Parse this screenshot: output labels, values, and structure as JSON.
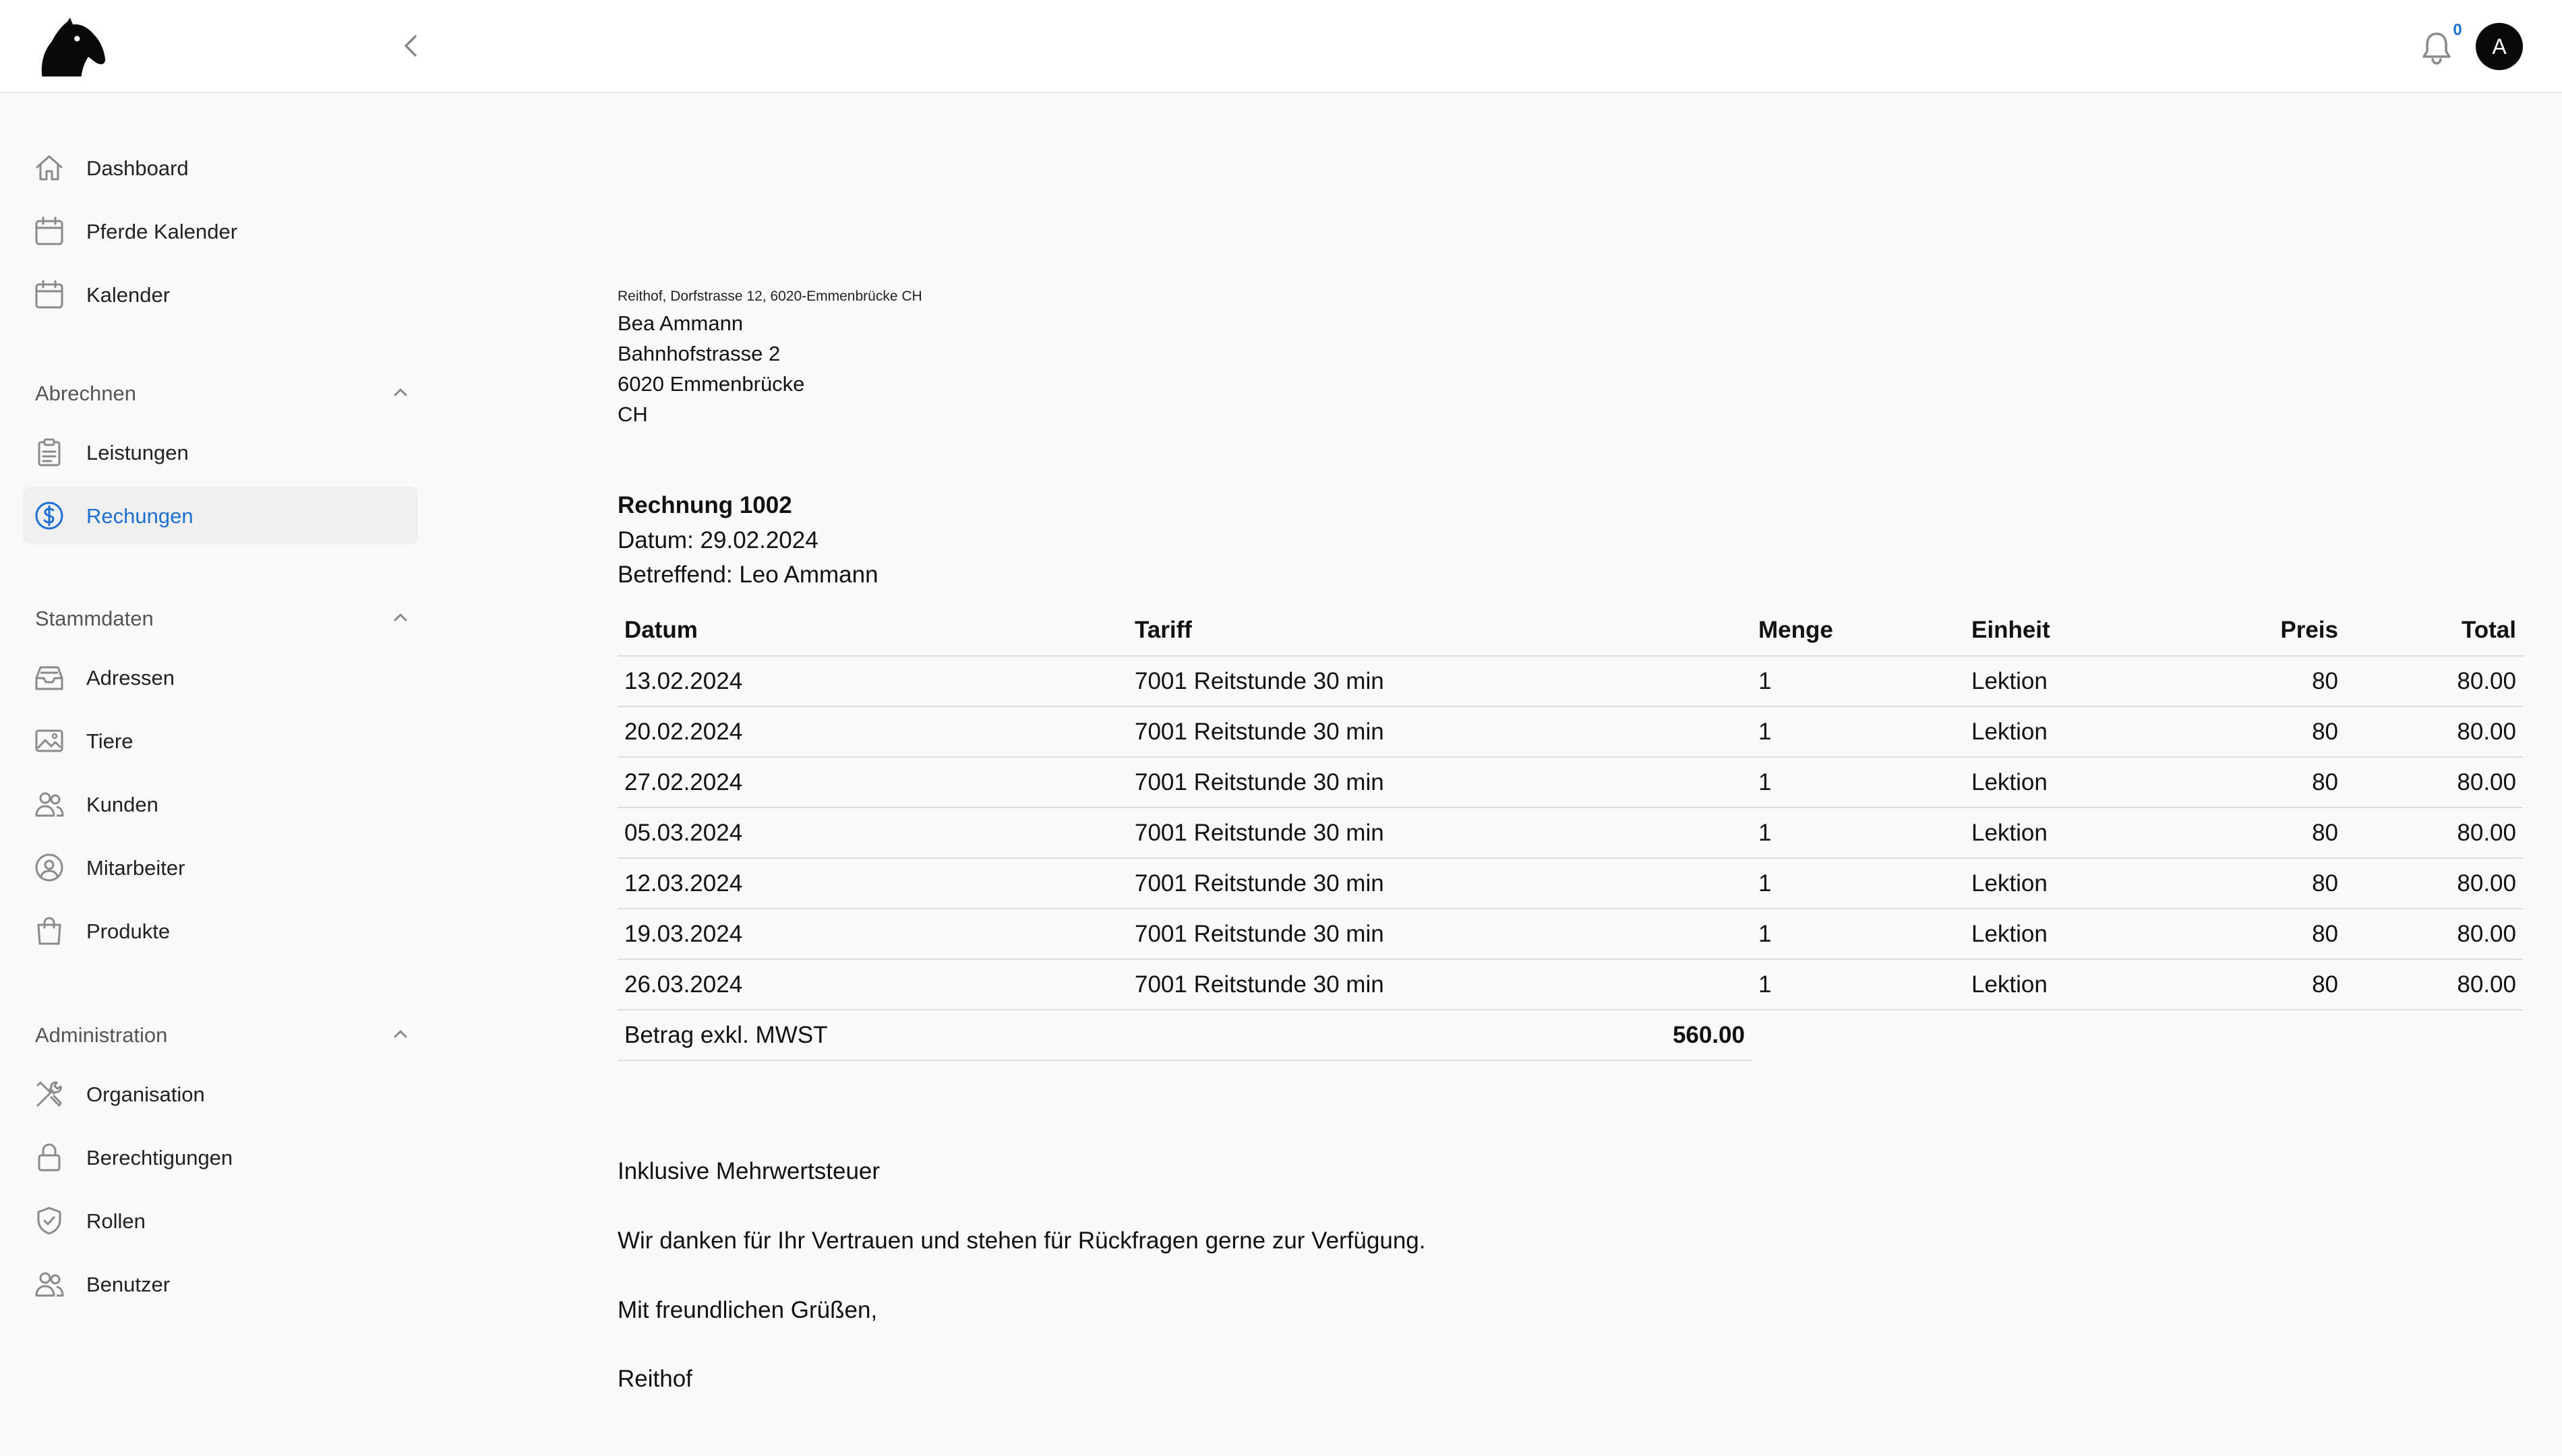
{
  "header": {
    "logo": "horse-head-logo",
    "notification_count": "0",
    "avatar_initial": "A"
  },
  "sidebar": {
    "top_items": [
      {
        "label": "Dashboard",
        "icon": "home-icon"
      },
      {
        "label": "Pferde Kalender",
        "icon": "calendar-icon"
      },
      {
        "label": "Kalender",
        "icon": "calendar-icon"
      }
    ],
    "sections": [
      {
        "label": "Abrechnen",
        "items": [
          {
            "label": "Leistungen",
            "icon": "clipboard-icon"
          },
          {
            "label": "Rechungen",
            "icon": "dollar-circle-icon",
            "active": true
          }
        ]
      },
      {
        "label": "Stammdaten",
        "items": [
          {
            "label": "Adressen",
            "icon": "inbox-icon"
          },
          {
            "label": "Tiere",
            "icon": "image-icon"
          },
          {
            "label": "Kunden",
            "icon": "users-icon"
          },
          {
            "label": "Mitarbeiter",
            "icon": "user-circle-icon"
          },
          {
            "label": "Produkte",
            "icon": "shopping-bag-icon"
          }
        ]
      },
      {
        "label": "Administration",
        "items": [
          {
            "label": "Organisation",
            "icon": "tools-icon"
          },
          {
            "label": "Berechtigungen",
            "icon": "lock-icon"
          },
          {
            "label": "Rollen",
            "icon": "shield-check-icon"
          },
          {
            "label": "Benutzer",
            "icon": "users-icon"
          }
        ]
      }
    ],
    "accent_color": "#1d6fd1"
  },
  "invoice": {
    "sender_line": "Reithof, Dorfstrasse 12, 6020-Emmenbrücke CH",
    "recipient": [
      "Bea Ammann",
      "Bahnhofstrasse 2",
      "6020 Emmenbrücke",
      "CH"
    ],
    "title": "Rechnung 1002",
    "date_line": "Datum: 29.02.2024",
    "subject_line": "Betreffend: Leo Ammann",
    "columns": [
      "Datum",
      "Tariff",
      "Menge",
      "Einheit",
      "Preis",
      "Total"
    ],
    "rows": [
      [
        "13.02.2024",
        "7001 Reitstunde 30 min",
        "1",
        "Lektion",
        "80",
        "80.00"
      ],
      [
        "20.02.2024",
        "7001 Reitstunde 30 min",
        "1",
        "Lektion",
        "80",
        "80.00"
      ],
      [
        "27.02.2024",
        "7001 Reitstunde 30 min",
        "1",
        "Lektion",
        "80",
        "80.00"
      ],
      [
        "05.03.2024",
        "7001 Reitstunde 30 min",
        "1",
        "Lektion",
        "80",
        "80.00"
      ],
      [
        "12.03.2024",
        "7001 Reitstunde 30 min",
        "1",
        "Lektion",
        "80",
        "80.00"
      ],
      [
        "19.03.2024",
        "7001 Reitstunde 30 min",
        "1",
        "Lektion",
        "80",
        "80.00"
      ],
      [
        "26.03.2024",
        "7001 Reitstunde 30 min",
        "1",
        "Lektion",
        "80",
        "80.00"
      ]
    ],
    "sum_label": "Betrag exkl. MWST",
    "sum_value": "560.00",
    "footer": [
      "Inklusive Mehrwertsteuer",
      "Wir danken für Ihr Vertrauen und stehen für Rückfragen gerne zur Verfügung.",
      "Mit freundlichen Grüßen,",
      "Reithof"
    ]
  }
}
